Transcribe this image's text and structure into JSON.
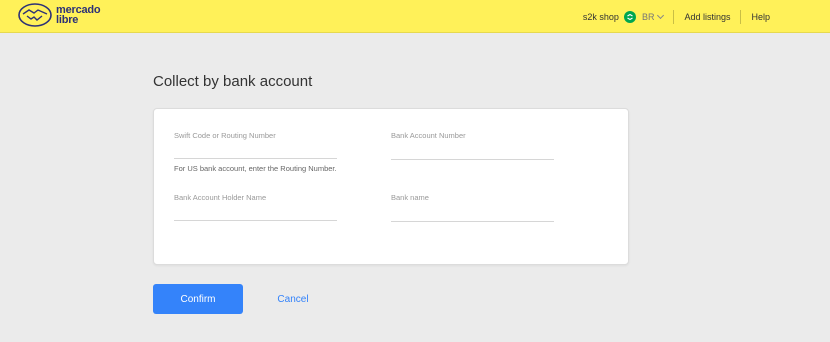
{
  "header": {
    "brand_line1": "mercado",
    "brand_line2": "libre",
    "shop_name": "s2k shop",
    "country": "BR",
    "add_listings": "Add listings",
    "help": "Help",
    "brand_color": "#fff159",
    "logo_color": "#2d3277"
  },
  "page": {
    "title": "Collect by bank account"
  },
  "form": {
    "swift_label": "Swift Code or Routing Number",
    "swift_help": "For US bank account, enter the Routing Number.",
    "account_number_label": "Bank Account Number",
    "holder_name_label": "Bank Account Holder Name",
    "bank_name_label": "Bank name"
  },
  "actions": {
    "confirm": "Confirm",
    "cancel": "Cancel",
    "accent": "#3483fa"
  }
}
